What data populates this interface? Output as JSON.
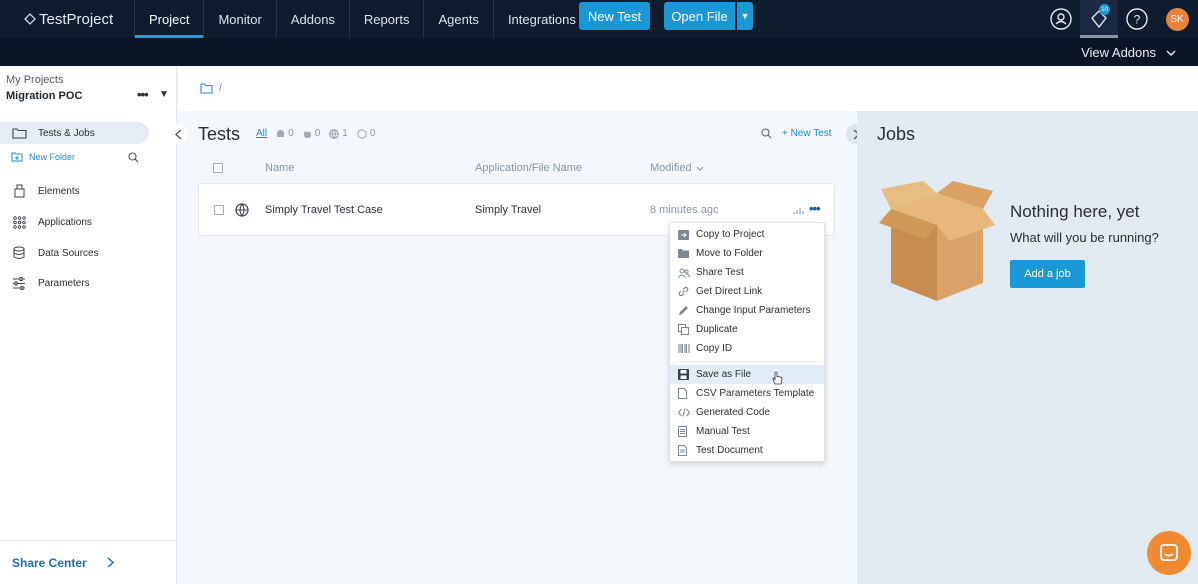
{
  "app": {
    "logo_text": "TestProject"
  },
  "nav": {
    "items": [
      "Project",
      "Monitor",
      "Addons",
      "Reports",
      "Agents",
      "Integrations"
    ],
    "new_test": "New Test",
    "open_file": "Open File",
    "notifications_count": "10",
    "avatar_initials": "SK"
  },
  "subbar": {
    "view_addons": "View Addons"
  },
  "sidebar": {
    "my_projects": "My Projects",
    "project_name": "Migration POC",
    "new_folder": "New Folder",
    "items": [
      "Tests & Jobs",
      "Elements",
      "Applications",
      "Data Sources",
      "Parameters"
    ],
    "share_center": "Share Center"
  },
  "breadcrumb": {
    "separator": "/"
  },
  "tests": {
    "title": "Tests",
    "filter_all": "All",
    "android_count": "0",
    "ios_count": "0",
    "web_count": "1",
    "generic_count": "0",
    "new_test": "+ New Test",
    "columns": [
      "Name",
      "Application/File Name",
      "Modified"
    ],
    "rows": [
      {
        "name": "Simply Travel Test Case",
        "app": "Simply Travel",
        "modified": "8 minutes agc"
      }
    ]
  },
  "menu": {
    "items": [
      "Copy to Project",
      "Move to Folder",
      "Share Test",
      "Get Direct Link",
      "Change Input Parameters",
      "Duplicate",
      "Copy ID"
    ],
    "items2": [
      "Save as File",
      "CSV Parameters Template",
      "Generated Code",
      "Manual Test",
      "Test Document"
    ]
  },
  "jobs": {
    "title": "Jobs",
    "empty_title": "Nothing here, yet",
    "empty_subtitle": "What will you be running?",
    "add_job": "Add a job"
  },
  "colors": {
    "accent": "#1a98d5",
    "nav_bg": "#0f1c2e",
    "orange": "#f08a30"
  }
}
